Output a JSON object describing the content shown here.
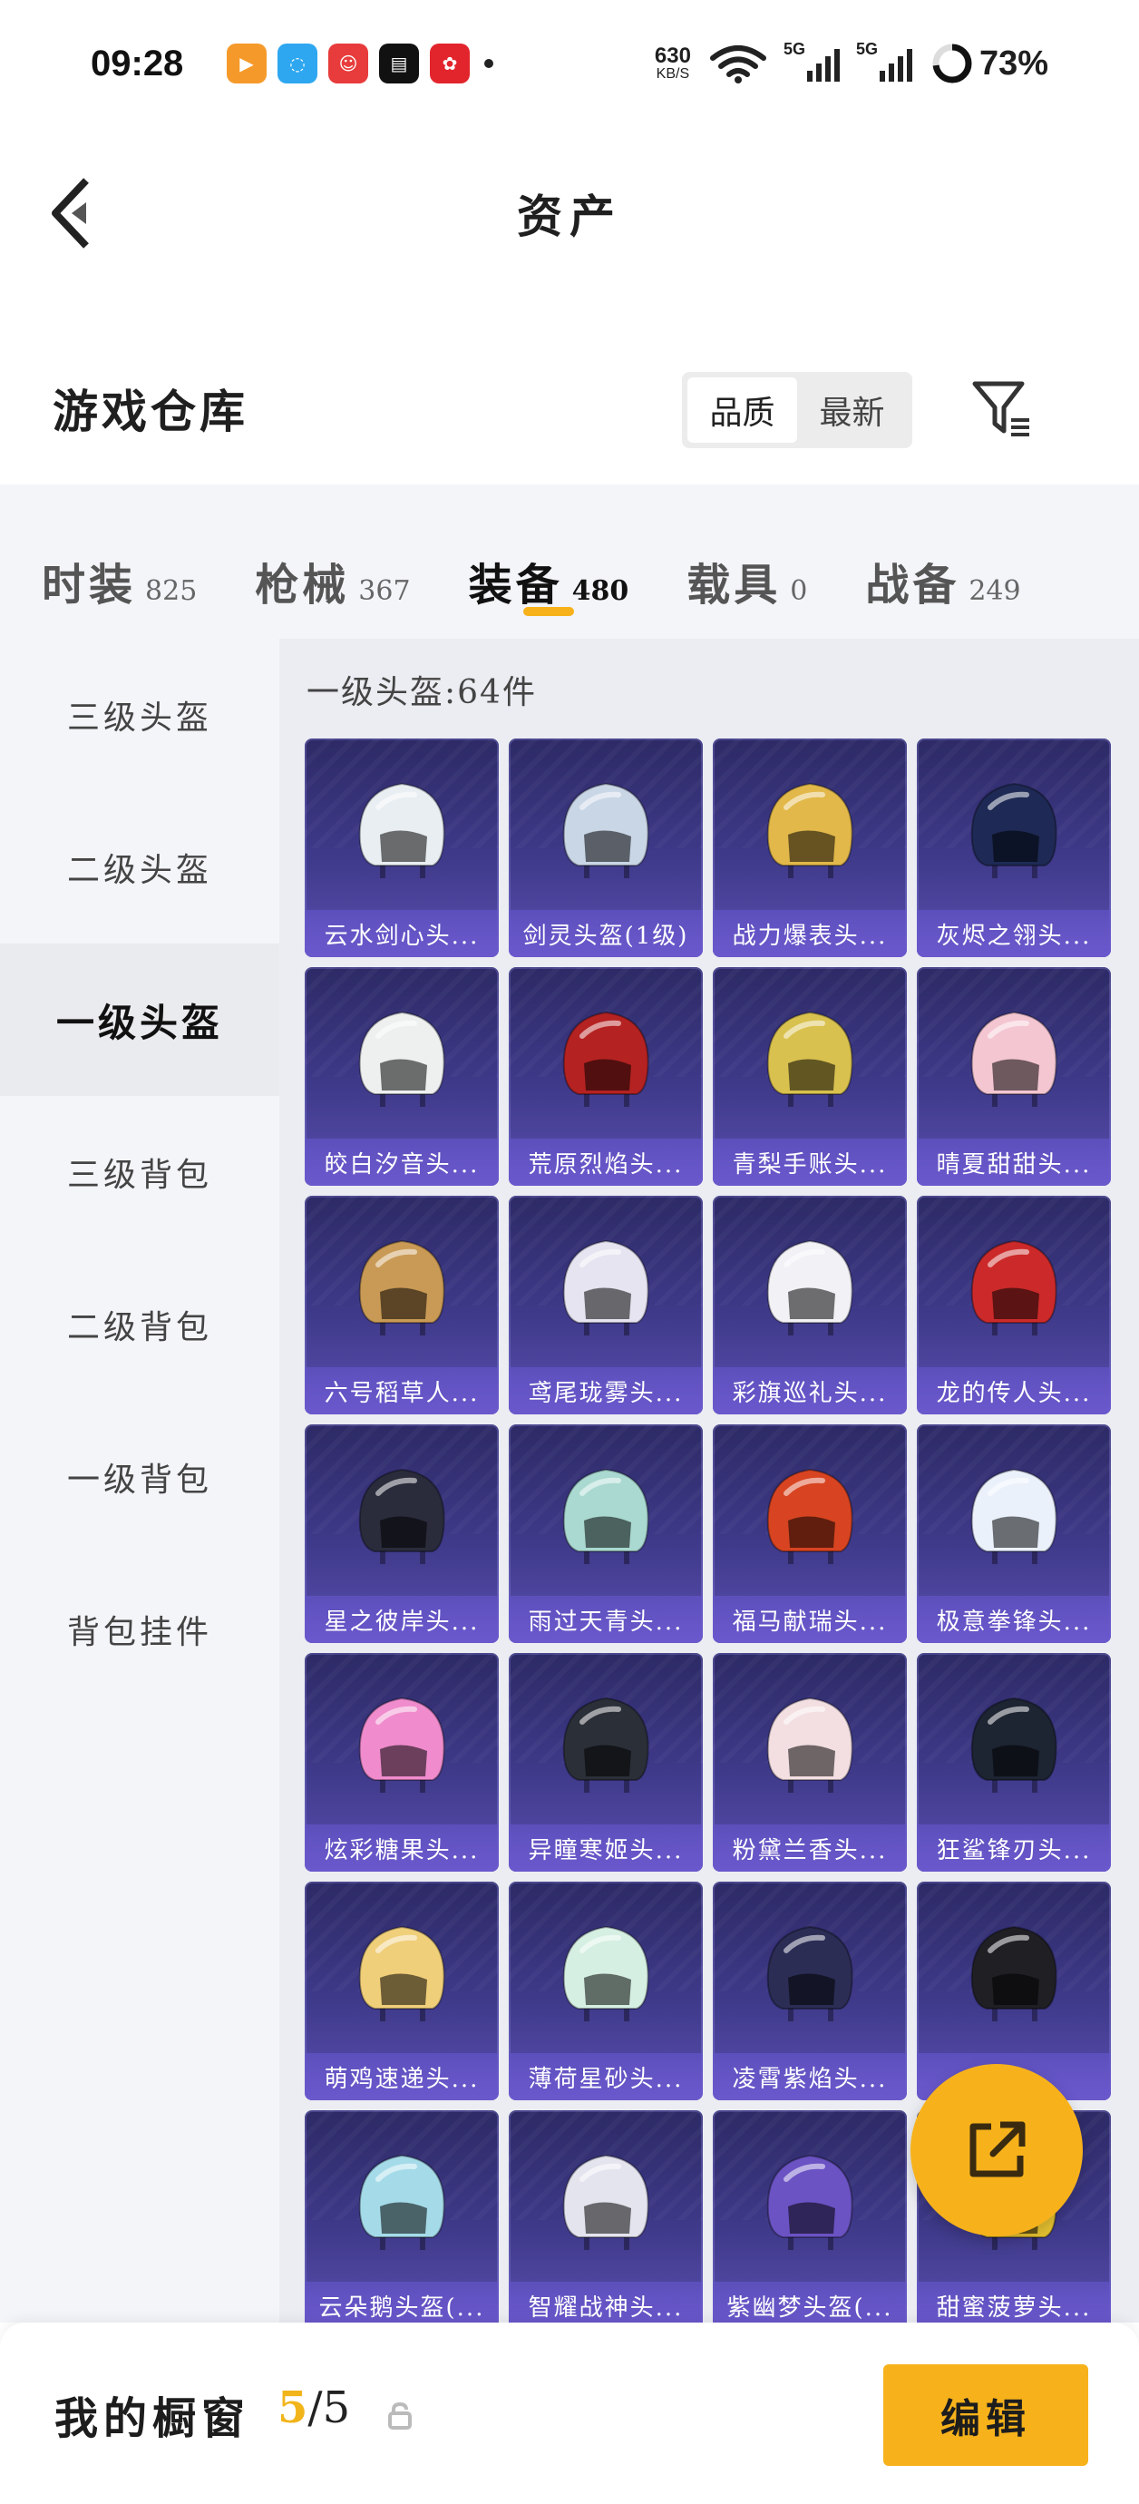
{
  "status_bar": {
    "time": "09:28",
    "net_speed": "630",
    "net_unit": "KB/S",
    "network_1": "5G",
    "network_2": "5G",
    "battery": "73%"
  },
  "header": {
    "title": "资产"
  },
  "warehouse": {
    "title": "游戏仓库",
    "sort_options": [
      "品质",
      "最新"
    ],
    "active_sort": "品质"
  },
  "tabs": [
    {
      "label": "时装",
      "count": "825"
    },
    {
      "label": "枪械",
      "count": "367"
    },
    {
      "label": "装备",
      "count": "480",
      "active": true
    },
    {
      "label": "载具",
      "count": "0"
    },
    {
      "label": "战备",
      "count": "249"
    }
  ],
  "sidebar": [
    {
      "label": "三级头盔"
    },
    {
      "label": "二级头盔"
    },
    {
      "label": "一级头盔",
      "active": true
    },
    {
      "label": "三级背包"
    },
    {
      "label": "二级背包"
    },
    {
      "label": "一级背包"
    },
    {
      "label": "背包挂件"
    }
  ],
  "section_title": "一级头盔:64件",
  "items": [
    {
      "name": "云水剑心头...",
      "color": "#e8eef2"
    },
    {
      "name": "剑灵头盔(1级)",
      "color": "#c9d6e6"
    },
    {
      "name": "战力爆表头...",
      "color": "#e2b84a"
    },
    {
      "name": "灰烬之翎头...",
      "color": "#1e2a55"
    },
    {
      "name": "皎白汐音头...",
      "color": "#eef0f0"
    },
    {
      "name": "荒原烈焰头...",
      "color": "#b52222"
    },
    {
      "name": "青梨手账头...",
      "color": "#d9c14f"
    },
    {
      "name": "晴夏甜甜头...",
      "color": "#f4c6d2"
    },
    {
      "name": "六号稻草人...",
      "color": "#c99a55"
    },
    {
      "name": "鸢尾珑雾头...",
      "color": "#e6e4f0"
    },
    {
      "name": "彩旗巡礼头...",
      "color": "#f1f1f6"
    },
    {
      "name": "龙的传人头...",
      "color": "#cc2a2a"
    },
    {
      "name": "星之彼岸头...",
      "color": "#2a2c3c"
    },
    {
      "name": "雨过天青头...",
      "color": "#a9d9d0"
    },
    {
      "name": "福马献瑞头...",
      "color": "#d84421"
    },
    {
      "name": "极意拳锋头...",
      "color": "#eaf1fb"
    },
    {
      "name": "炫彩糖果头...",
      "color": "#f08ccd"
    },
    {
      "name": "异瞳寒姬头...",
      "color": "#2b2f38"
    },
    {
      "name": "粉黛兰香头...",
      "color": "#f3dfe2"
    },
    {
      "name": "狂鲨锋刃头...",
      "color": "#1d2432"
    },
    {
      "name": "萌鸡速递头...",
      "color": "#f0cf7a"
    },
    {
      "name": "薄荷星砂头...",
      "color": "#d5efe2"
    },
    {
      "name": "凌霄紫焰头...",
      "color": "#2b2d55"
    },
    {
      "name": "绯...",
      "color": "#1f1f24"
    },
    {
      "name": "云朵鹅头盔(...",
      "color": "#a5dbe9"
    },
    {
      "name": "智耀战神头...",
      "color": "#e4e4ef"
    },
    {
      "name": "紫幽梦头盔(...",
      "color": "#6b53c4"
    },
    {
      "name": "甜蜜菠萝头...",
      "color": "#e6c231"
    }
  ],
  "bottom_bar": {
    "label": "我的橱窗",
    "current": "5",
    "total": "/5",
    "edit_label": "编辑"
  },
  "colors": {
    "accent": "#f7b21b",
    "card_bg": "#3f3a8a"
  }
}
